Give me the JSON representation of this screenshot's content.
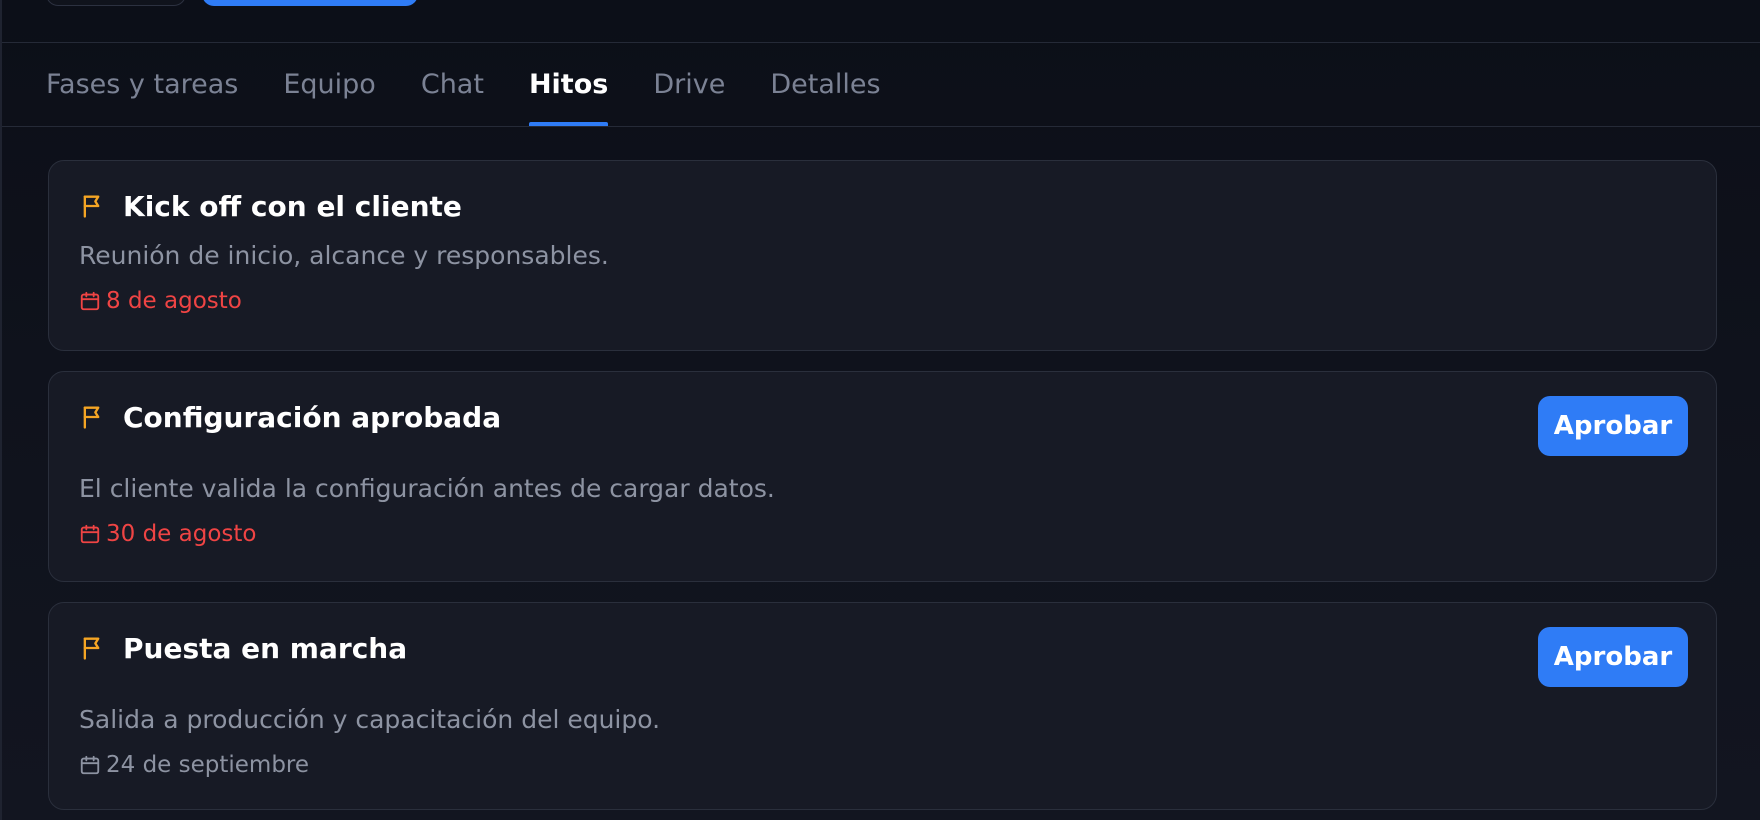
{
  "tabs": [
    {
      "label": "Fases y tareas",
      "active": false
    },
    {
      "label": "Equipo",
      "active": false
    },
    {
      "label": "Chat",
      "active": false
    },
    {
      "label": "Hitos",
      "active": true
    },
    {
      "label": "Drive",
      "active": false
    },
    {
      "label": "Detalles",
      "active": false
    }
  ],
  "milestones": [
    {
      "title": "Kick off con el cliente",
      "description": "Reunión de inicio, alcance y responsables.",
      "date": "8 de agosto",
      "overdue": true,
      "action_label": ""
    },
    {
      "title": "Configuración aprobada",
      "description": "El cliente valida la configuración antes de cargar datos.",
      "date": "30 de agosto",
      "overdue": true,
      "action_label": "Aprobar"
    },
    {
      "title": "Puesta en marcha",
      "description": "Salida a producción y capacitación del equipo.",
      "date": "24 de septiembre",
      "overdue": false,
      "action_label": "Aprobar"
    }
  ],
  "icons": {
    "milestone": "flag-icon",
    "date": "calendar-icon"
  },
  "colors": {
    "accent": "#2f7cf6",
    "flag": "#f5a524",
    "overdue": "#ef4444",
    "muted": "#8d93a2"
  }
}
